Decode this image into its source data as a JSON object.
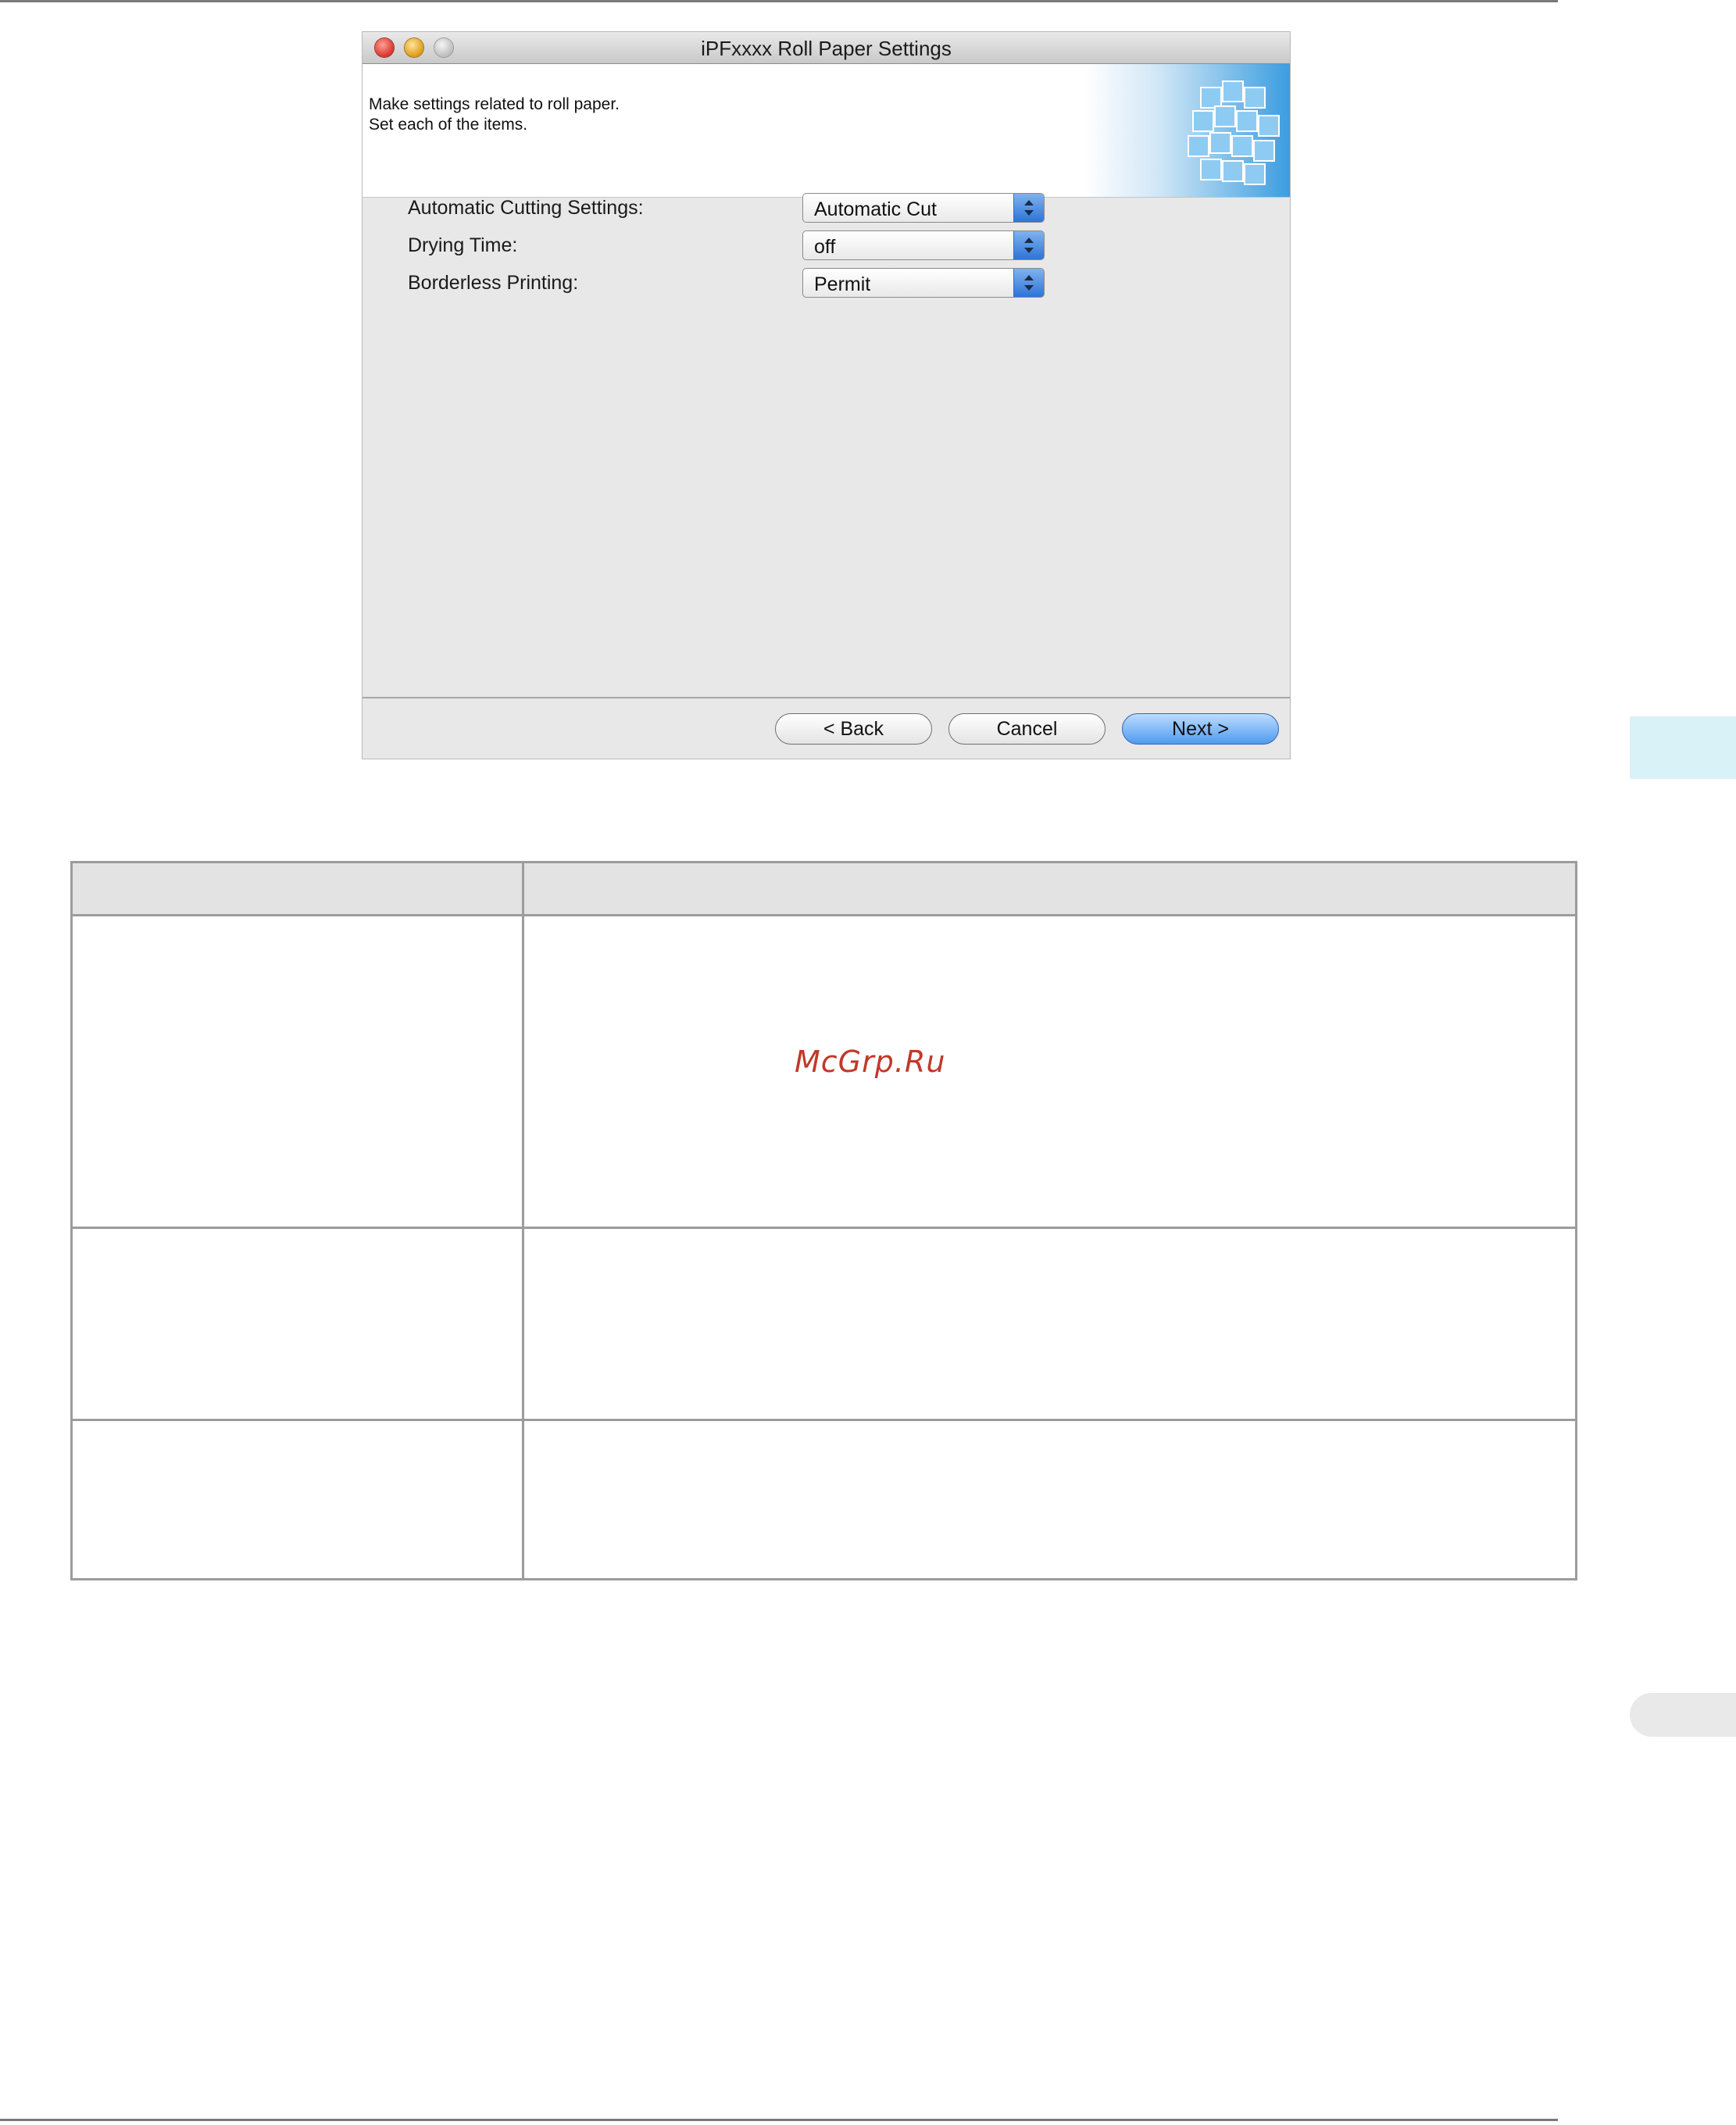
{
  "window": {
    "title": "iPFxxxx  Roll Paper Settings",
    "description_line1": "Make settings related to roll paper.",
    "description_line2": "Set each of the items."
  },
  "settings": [
    {
      "label": "Automatic Cutting Settings:",
      "value": "Automatic Cut"
    },
    {
      "label": "Drying Time:",
      "value": "off"
    },
    {
      "label": "Borderless Printing:",
      "value": "Permit"
    }
  ],
  "buttons": {
    "back": "< Back",
    "cancel": "Cancel",
    "next": "Next >"
  },
  "watermark": "McGrp.Ru",
  "colors": {
    "primary_button": "#4f9bf0",
    "side_tab": "#d9f2f7",
    "watermark": "#c0392b"
  }
}
